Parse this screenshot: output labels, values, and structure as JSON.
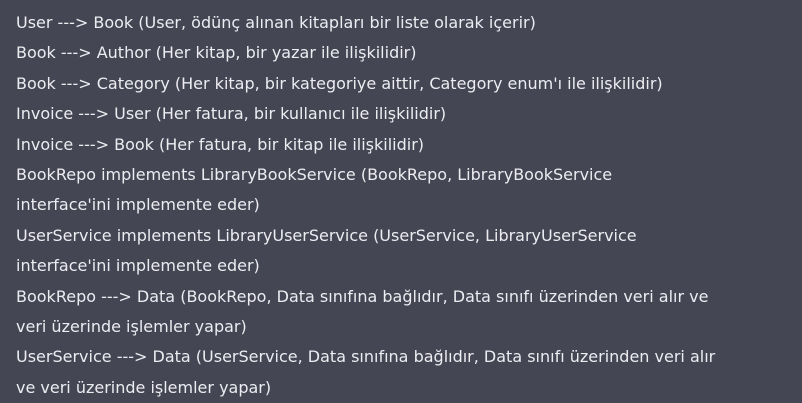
{
  "lines": [
    "User ---> Book (User, ödünç alınan kitapları bir liste olarak içerir)",
    "Book ---> Author (Her kitap, bir yazar ile ilişkilidir)",
    "Book ---> Category (Her kitap, bir kategoriye aittir, Category enum'ı ile ilişkilidir)",
    "Invoice ---> User (Her fatura, bir kullanıcı ile ilişkilidir)",
    "Invoice ---> Book (Her fatura, bir kitap ile ilişkilidir)",
    "BookRepo implements LibraryBookService (BookRepo, LibraryBookService",
    "interface'ini implemente eder)",
    "UserService implements LibraryUserService (UserService, LibraryUserService",
    "interface'ini implemente eder)",
    "BookRepo ---> Data (BookRepo, Data sınıfına bağlıdır, Data sınıfı üzerinden veri alır ve",
    "veri üzerinde işlemler yapar)",
    "UserService ---> Data (UserService, Data sınıfına bağlıdır, Data sınıfı üzerinden veri alır",
    "ve veri üzerinde işlemler yapar)"
  ]
}
